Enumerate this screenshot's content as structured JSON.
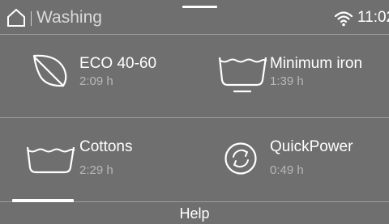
{
  "header": {
    "title": "Washing",
    "time": "11:02"
  },
  "programs": [
    {
      "name": "ECO 40-60",
      "duration": "2:09 h",
      "icon": "leaf-icon"
    },
    {
      "name": "Minimum iron",
      "duration": "1:39  h",
      "icon": "minimum-iron-tub-icon"
    },
    {
      "name": "Cottons",
      "duration": "2:29  h",
      "icon": "cotton-tub-icon"
    },
    {
      "name": "QuickPower",
      "duration": "0:49  h",
      "icon": "quickpower-icon"
    }
  ],
  "footer": {
    "help_label": "Help"
  },
  "colors": {
    "background": "#6f6f6f",
    "text": "#ffffff",
    "secondary_text": "#b7b7b7",
    "divider": "#9c9c9c"
  }
}
